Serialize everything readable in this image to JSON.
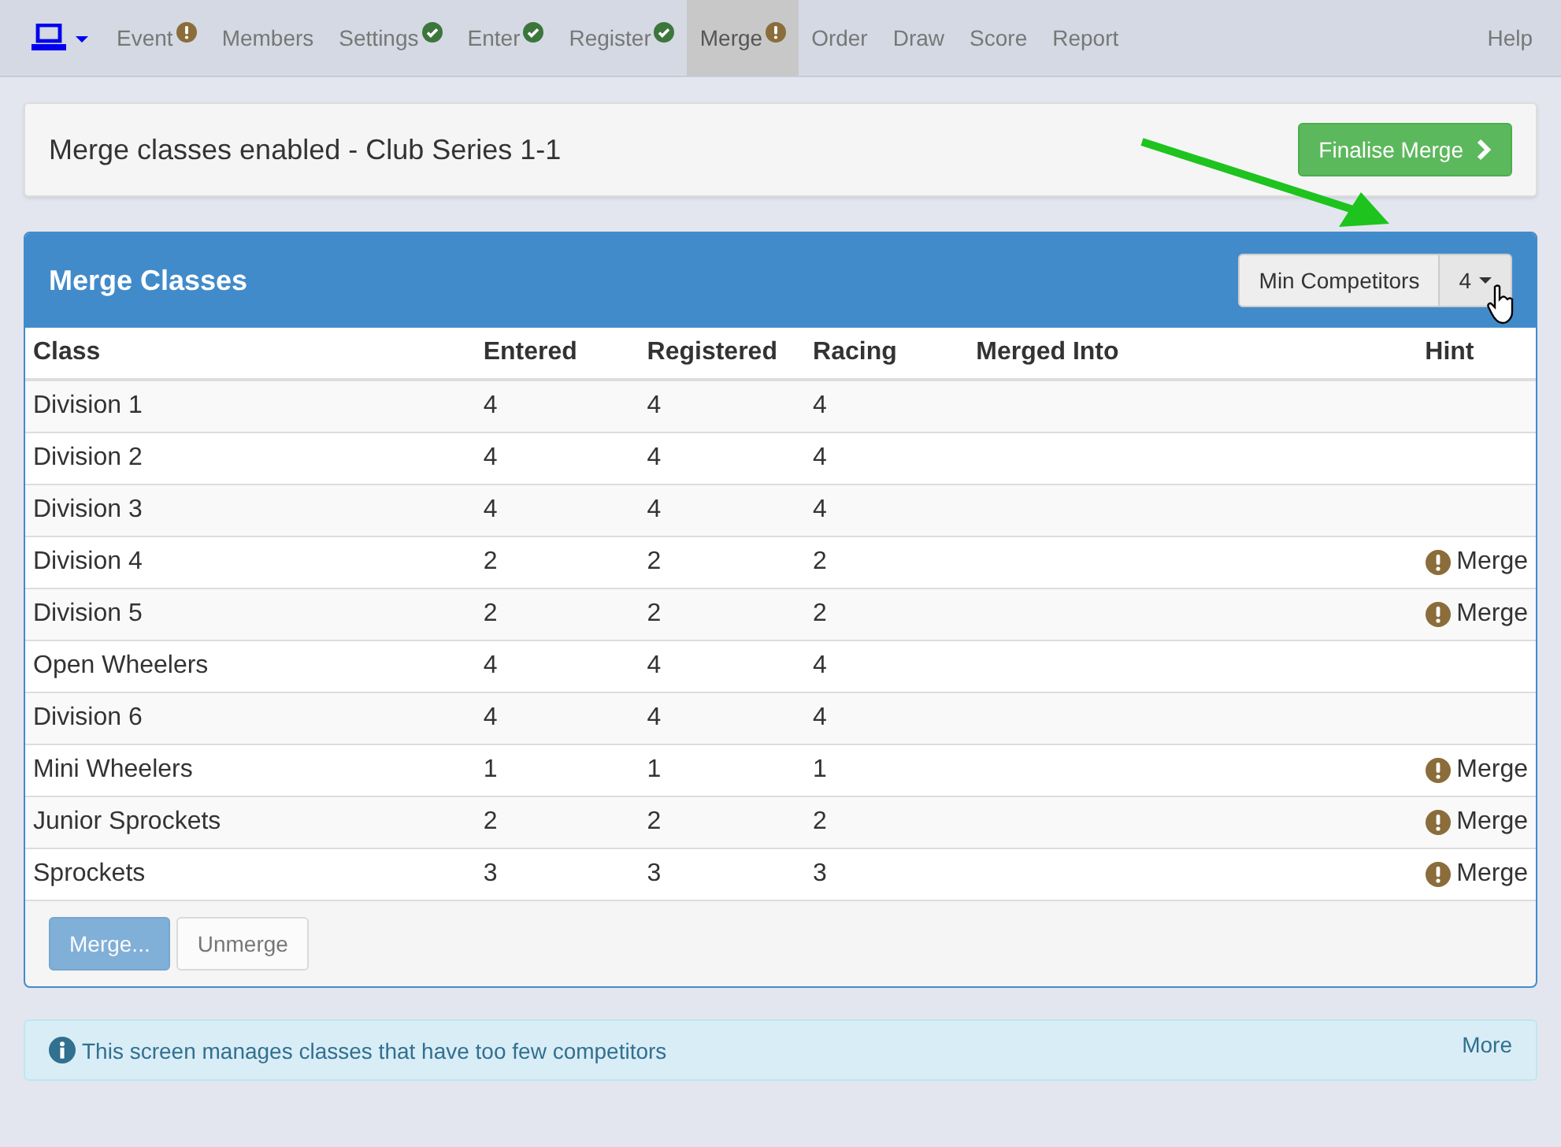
{
  "nav": {
    "items": [
      {
        "label": "Event",
        "kind": "warning",
        "selected": false
      },
      {
        "label": "Members",
        "kind": "plain",
        "selected": false
      },
      {
        "label": "Settings",
        "kind": "done",
        "selected": false
      },
      {
        "label": "Enter",
        "kind": "done",
        "selected": false
      },
      {
        "label": "Register",
        "kind": "done",
        "selected": false
      },
      {
        "label": "Merge",
        "kind": "warning",
        "selected": true
      },
      {
        "label": "Order",
        "kind": "plain",
        "selected": false
      },
      {
        "label": "Draw",
        "kind": "plain",
        "selected": false
      },
      {
        "label": "Score",
        "kind": "plain",
        "selected": false
      },
      {
        "label": "Report",
        "kind": "plain",
        "selected": false
      }
    ],
    "help": "Help"
  },
  "banner": {
    "title": "Merge classes enabled - Club Series 1-1",
    "button": "Finalise Merge"
  },
  "panel": {
    "title": "Merge Classes",
    "min_label": "Min Competitors",
    "min_value": "4",
    "table": {
      "columns": [
        "Class",
        "Entered",
        "Registered",
        "Racing",
        "Merged Into",
        "Hint"
      ],
      "rows": [
        {
          "class": "Division 1",
          "entered": "4",
          "registered": "4",
          "racing": "4"
        },
        {
          "class": "Division 2",
          "entered": "4",
          "registered": "4",
          "racing": "4"
        },
        {
          "class": "Division 3",
          "entered": "4",
          "registered": "4",
          "racing": "4"
        },
        {
          "class": "Division 4",
          "entered": "2",
          "registered": "2",
          "racing": "2",
          "hint": "Merge"
        },
        {
          "class": "Division 5",
          "entered": "2",
          "registered": "2",
          "racing": "2",
          "hint": "Merge"
        },
        {
          "class": "Open Wheelers",
          "entered": "4",
          "registered": "4",
          "racing": "4"
        },
        {
          "class": "Division 6",
          "entered": "4",
          "registered": "4",
          "racing": "4"
        },
        {
          "class": "Mini Wheelers",
          "entered": "1",
          "registered": "1",
          "racing": "1",
          "hint": "Merge"
        },
        {
          "class": "Junior Sprockets",
          "entered": "2",
          "registered": "2",
          "racing": "2",
          "hint": "Merge"
        },
        {
          "class": "Sprockets",
          "entered": "3",
          "registered": "3",
          "racing": "3",
          "hint": "Merge"
        }
      ]
    },
    "buttons": [
      {
        "label": "Merge...",
        "kind": "primary",
        "disabled": true
      },
      {
        "label": "Unmerge",
        "kind": "default",
        "disabled": true
      }
    ]
  },
  "info": {
    "text": "This screen manages classes that have too few competitors",
    "link": "More"
  }
}
